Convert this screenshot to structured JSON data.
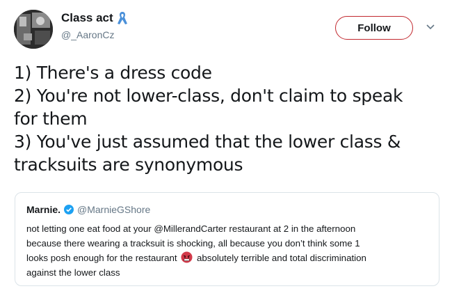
{
  "tweet": {
    "author": {
      "display_name": "Class act",
      "handle": "@_AaronCz",
      "name_badge_icon": "awareness-ribbon-icon"
    },
    "follow_label": "Follow",
    "text_lines": [
      "1) There's a dress code",
      "2) You're not lower-class, don't claim to speak",
      "for them",
      "3) You've just assumed that the lower class &",
      "tracksuits are synonymous"
    ]
  },
  "quoted_tweet": {
    "display_name": "Marnie.",
    "verified_icon": "verified-badge-icon",
    "handle": "@MarnieGShore",
    "text_lines": [
      "not letting one eat food at your @MillerandCarter restaurant at 2 in the afternoon",
      "because there wearing a tracksuit is shocking, all because you don’t think some 1",
      "looks posh enough for the restaurant",
      "absolutely terrible and total discrimination",
      "against the lower class"
    ],
    "emoji": "angry-face-icon"
  },
  "colors": {
    "follow_border": "#c1272d",
    "verified_blue": "#1da1f2",
    "ribbon_blue": "#4a90d9",
    "muted_text": "#657786",
    "card_border": "#dbe3e8"
  }
}
